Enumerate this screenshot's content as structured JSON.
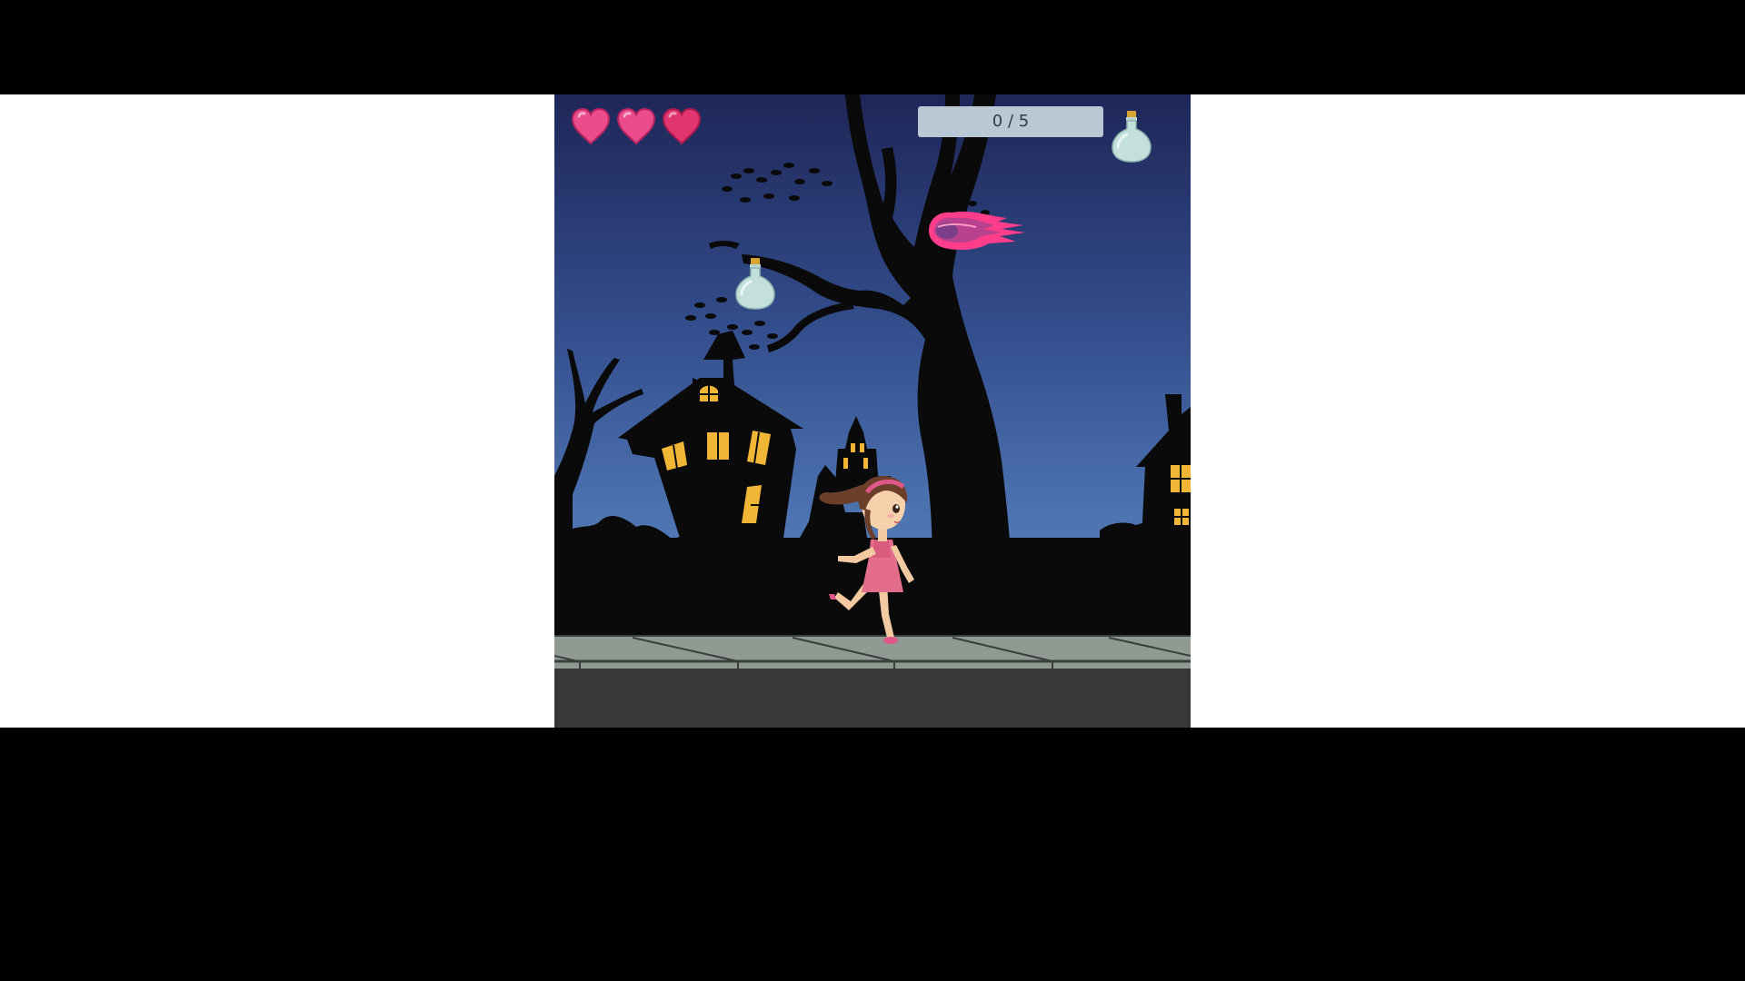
{
  "hud": {
    "lives": 3,
    "lives_max": 3,
    "potions_collected": 0,
    "potions_total": 5,
    "progress_label": "0 / 5",
    "heart_icon": "heart-icon",
    "potion_icon": "potion-bottle-icon"
  },
  "scene": {
    "sky_top_color": "#1e2658",
    "sky_bottom_color": "#5a86c4",
    "silhouette_color": "#0a0a0a",
    "window_color": "#f2b637",
    "sidewalk_color": "#8f9a92",
    "road_color": "#383838"
  },
  "entities": {
    "player": "running-girl",
    "pickup": "potion-bottle",
    "hazard": "pink-fireball"
  }
}
